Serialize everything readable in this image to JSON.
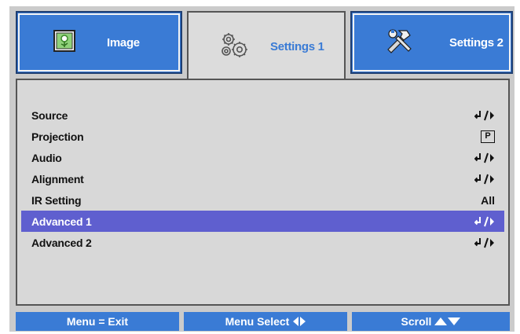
{
  "tabs": [
    {
      "label": "Image",
      "icon": "image-icon",
      "active": false
    },
    {
      "label": "Settings 1",
      "icon": "gears-icon",
      "active": true
    },
    {
      "label": "Settings 2",
      "icon": "tools-icon",
      "active": false
    }
  ],
  "menu": {
    "items": [
      {
        "label": "Source",
        "value": "",
        "value_icon": "enter-icon"
      },
      {
        "label": "Projection",
        "value": "P",
        "value_icon": "projection-icon"
      },
      {
        "label": "Audio",
        "value": "",
        "value_icon": "enter-icon"
      },
      {
        "label": "Alignment",
        "value": "",
        "value_icon": "enter-icon"
      },
      {
        "label": "IR Setting",
        "value": "All",
        "value_icon": ""
      },
      {
        "label": "Advanced 1",
        "value": "",
        "value_icon": "enter-icon",
        "selected": true
      },
      {
        "label": "Advanced 2",
        "value": "",
        "value_icon": "enter-icon"
      }
    ]
  },
  "bottom_bar": {
    "exit_label": "Menu = Exit",
    "select_label": "Menu Select",
    "scroll_label": "Scroll"
  },
  "colors": {
    "tab_blue": "#3a7bd5",
    "highlight": "#5f5fcf",
    "panel": "#d8d8d8",
    "frame": "#cbcbcb"
  }
}
